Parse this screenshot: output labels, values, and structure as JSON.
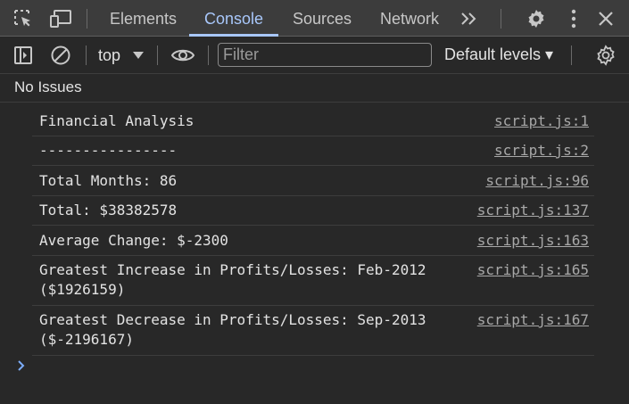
{
  "tabs": [
    {
      "label": "Elements",
      "active": false
    },
    {
      "label": "Console",
      "active": true
    },
    {
      "label": "Sources",
      "active": false
    },
    {
      "label": "Network",
      "active": false
    }
  ],
  "toolbar": {
    "context": "top",
    "filter_placeholder": "Filter",
    "levels": "Default levels ▾"
  },
  "issues": "No Issues",
  "logs": [
    {
      "message": "Financial Analysis",
      "source": "script.js:1"
    },
    {
      "message": "----------------",
      "source": "script.js:2"
    },
    {
      "message": "Total Months: 86",
      "source": "script.js:96"
    },
    {
      "message": "Total: $38382578",
      "source": "script.js:137"
    },
    {
      "message": "Average Change: $-2300",
      "source": "script.js:163"
    },
    {
      "message": "Greatest Increase in Profits/Losses: Feb-2012\n($1926159)",
      "source": "script.js:165"
    },
    {
      "message": "Greatest Decrease in Profits/Losses: Sep-2013\n($-2196167)",
      "source": "script.js:167"
    }
  ],
  "colors": {
    "accent": "#a8c7fa",
    "background": "#282828",
    "tabbar": "#3c3c3c"
  },
  "icons": [
    "inspect-element-icon",
    "device-toolbar-icon",
    "more-tabs-icon",
    "settings-icon",
    "more-options-icon",
    "close-icon",
    "sidebar-icon",
    "clear-console-icon",
    "live-expression-icon",
    "console-settings-icon",
    "prompt-chevron-icon"
  ]
}
